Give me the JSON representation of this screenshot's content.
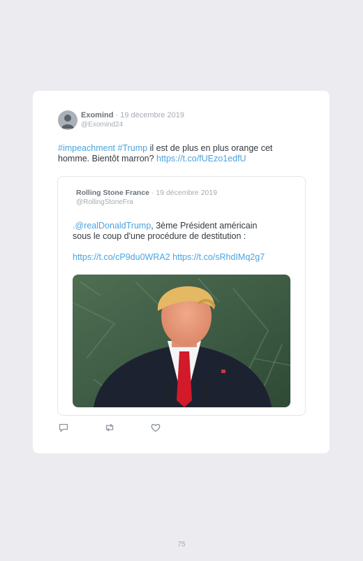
{
  "tweet": {
    "author_name": "Exomind",
    "date": "19 décembre 2019",
    "handle": "@Exomind24",
    "hashtag1": "#impeachment",
    "hashtag2": "#Trump",
    "text_line1": " il est de plus en plus orange cet",
    "text_line2": "homme. Bientôt marron? ",
    "link": "https://t.co/fUEzo1edfU"
  },
  "quoted": {
    "author_name": "Rolling Stone France",
    "date": "19 décembre 2019",
    "handle": "@RollingStoneFra",
    "prefix": ".",
    "mention": "@realDonaldTrump",
    "text_line1": ", 3ème Président américain",
    "text_line2": "sous le coup d'une procédure de destitution :",
    "link1": "https://t.co/cP9du0WRA2",
    "link2": "https://t.co/sRhdIMq2g7"
  },
  "actions": {
    "reply_icon": "reply-icon",
    "retweet_icon": "retweet-icon",
    "like_icon": "like-icon"
  },
  "page_number": "75"
}
